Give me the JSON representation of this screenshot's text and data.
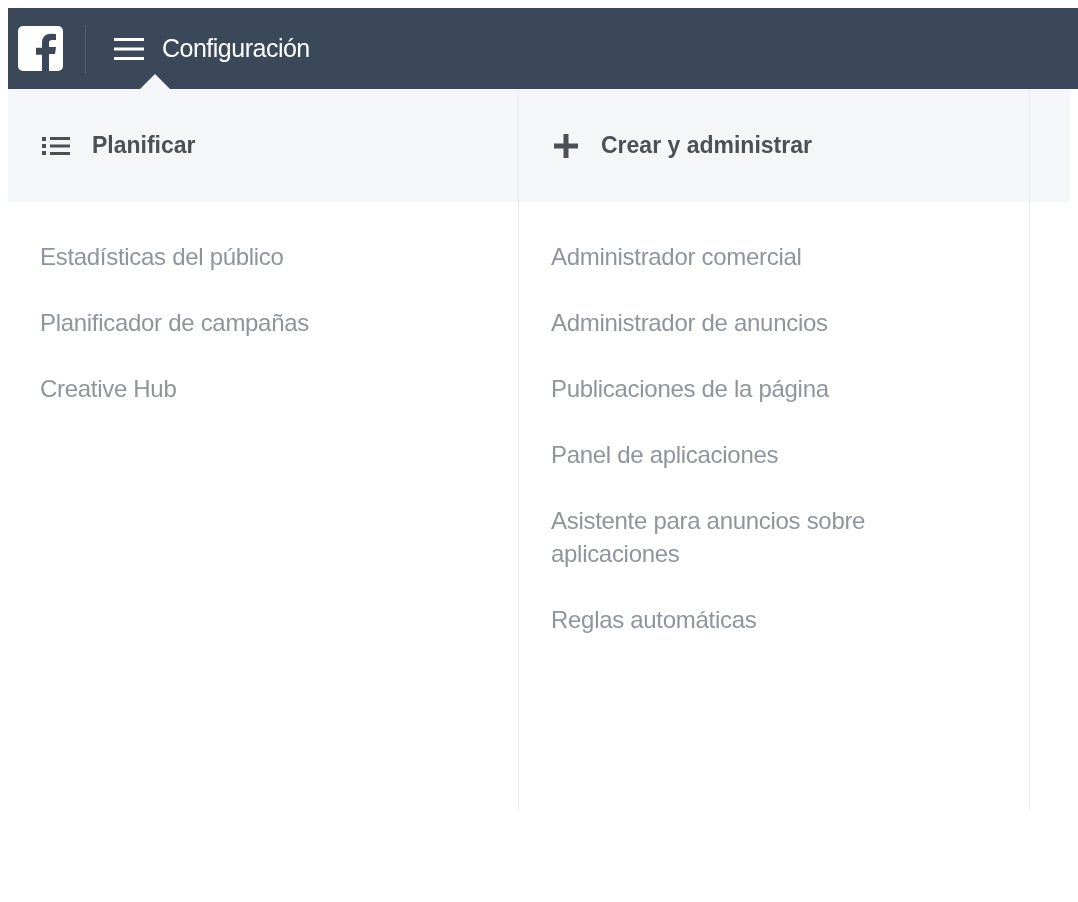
{
  "top_bar": {
    "menu_title": "Configuración"
  },
  "columns": [
    {
      "title": "Planificar",
      "kind": "list",
      "items": [
        "Estadísticas del público",
        "Planificador de campañas",
        "Creative Hub"
      ]
    },
    {
      "title": "Crear y administrar",
      "kind": "plus",
      "items": [
        "Administrador comercial",
        "Administrador de anuncios",
        "Publicaciones de la página",
        "Panel de aplicaciones",
        "Asistente para anuncios sobre aplicaciones",
        "Reglas automáticas"
      ]
    }
  ]
}
